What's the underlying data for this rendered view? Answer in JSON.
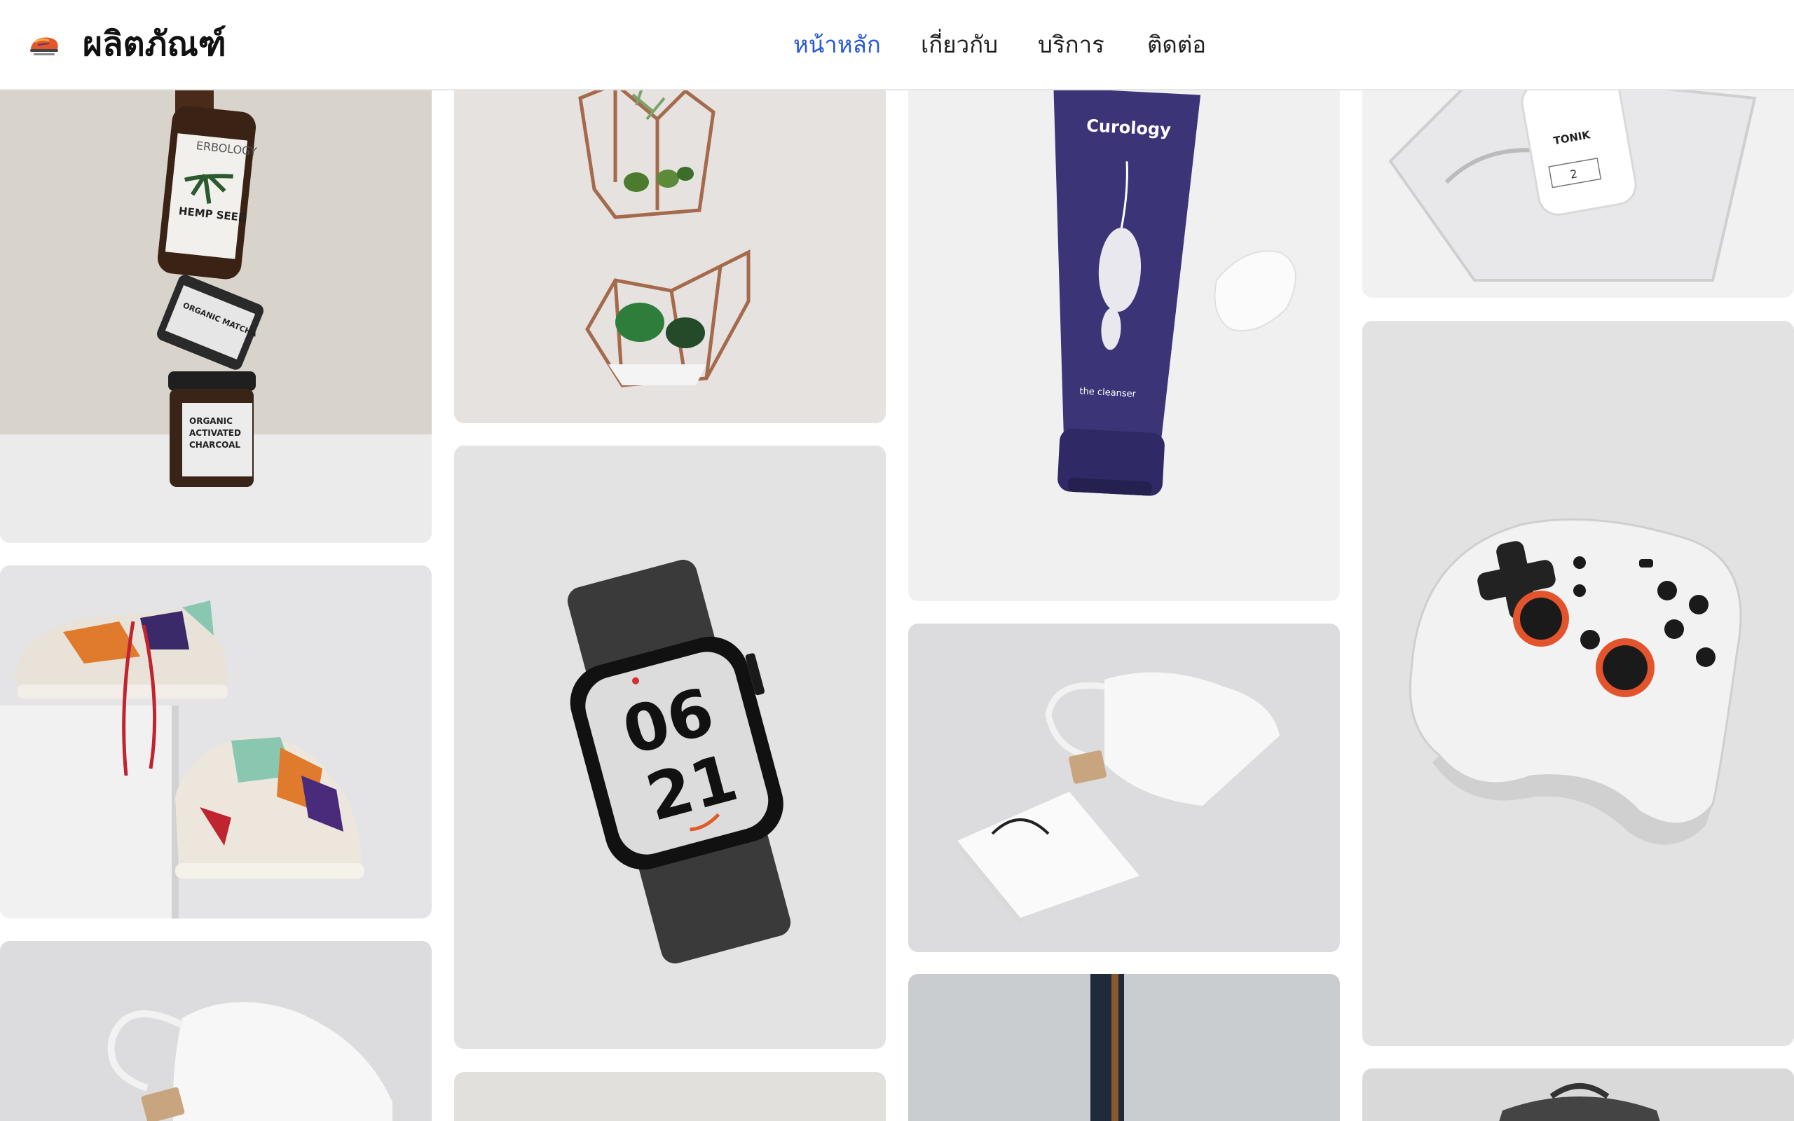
{
  "brand": {
    "name": "ผลิตภัณฑ์",
    "logo_icon": "sneaker-logo-icon"
  },
  "nav": {
    "items": [
      {
        "label": "หน้าหลัก",
        "active": true
      },
      {
        "label": "เกี่ยวกับ",
        "active": false
      },
      {
        "label": "บริการ",
        "active": false
      },
      {
        "label": "ติดต่อ",
        "active": false
      }
    ]
  },
  "colors": {
    "accent": "#2557d6",
    "text": "#1f1f1f",
    "border": "#e6e6e6"
  },
  "gallery": {
    "products": [
      {
        "name": "erbology-jars",
        "jar_brand": "ERBOLOGY",
        "bottle_label": "HEMP SEED",
        "jar_mid_label": "ORGANIC CEREMONIAL UJI MATCHA",
        "jar_bottom_label": "ORGANIC ACTIVATED CHARCOAL"
      },
      {
        "name": "sneakers"
      },
      {
        "name": "cotton-pouch"
      },
      {
        "name": "terrarium-planters"
      },
      {
        "name": "smartwatch",
        "watch_time_top": "06",
        "watch_time_bottom": "21"
      },
      {
        "name": "curology-tube",
        "tube_brand": "Curology",
        "tube_label": "the cleanser"
      },
      {
        "name": "pouch-and-bag"
      },
      {
        "name": "strap-on-grey"
      },
      {
        "name": "toner-bottle",
        "bottle_label": "TONIK"
      },
      {
        "name": "game-controller"
      },
      {
        "name": "leather-backpack"
      }
    ]
  }
}
